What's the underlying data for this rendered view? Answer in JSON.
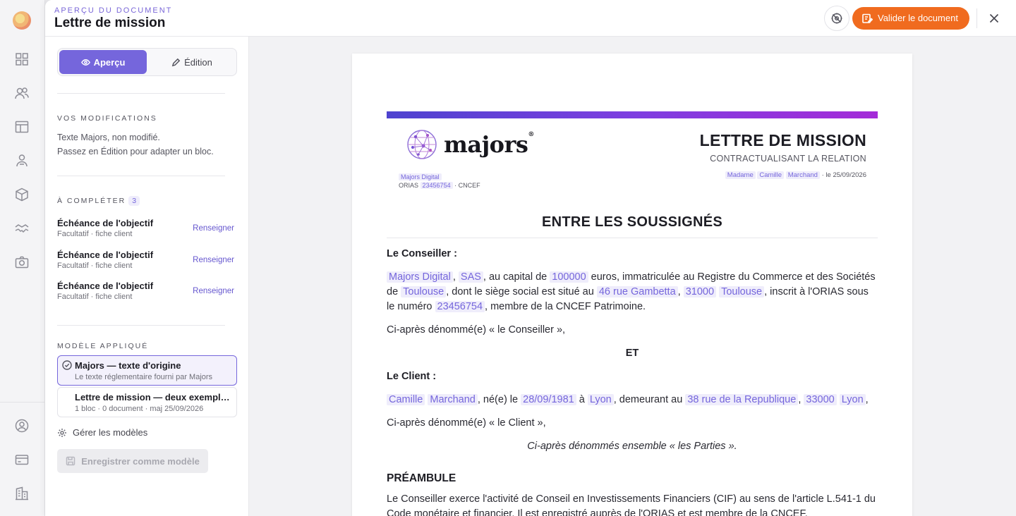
{
  "rail": {
    "icons": [
      "dashboard-icon",
      "users-icon",
      "layout-icon",
      "person-icon",
      "box-icon",
      "handshake-icon",
      "camera-icon",
      "account-icon",
      "card-icon",
      "building-icon"
    ]
  },
  "header": {
    "eyebrow": "APERÇU DU DOCUMENT",
    "title": "Lettre de mission",
    "validate_label": "Valider le document"
  },
  "panel": {
    "tabs": {
      "preview": "Aperçu",
      "edit": "Édition"
    },
    "modifications": {
      "title": "VOS MODIFICATIONS",
      "line1": "Texte Majors, non modifié.",
      "line2": "Passez en Édition pour adapter un bloc."
    },
    "todo": {
      "title": "À COMPLÉTER",
      "count": "3",
      "items": [
        {
          "title": "Échéance de l'objectif",
          "sub": "Facultatif · fiche client",
          "action": "Renseigner"
        },
        {
          "title": "Échéance de l'objectif",
          "sub": "Facultatif · fiche client",
          "action": "Renseigner"
        },
        {
          "title": "Échéance de l'objectif",
          "sub": "Facultatif · fiche client",
          "action": "Renseigner"
        }
      ]
    },
    "templates": {
      "title": "MODÈLE APPLIQUÉ",
      "items": [
        {
          "title": "Majors — texte d'origine",
          "sub": "Le texte réglementaire fourni par Majors"
        },
        {
          "title": "Lettre de mission — deux exemplaires",
          "sub": "1 bloc · 0 document · maj 25/09/2026"
        }
      ],
      "manage": "Gérer les modèles",
      "save": "Enregistrer comme modèle"
    }
  },
  "doc": {
    "brand": "majors",
    "org_name": "Majors Digital",
    "orias_label": "ORIAS",
    "orias_number": "23456754",
    "org_suffix": "· CNCEF",
    "title": "LETTRE DE MISSION",
    "subtitle": "CONTRACTUALISANT LA RELATION",
    "civility": "Madame",
    "first_name": "Camille",
    "last_name": "Marchand",
    "date_text": "· le 25/09/2026",
    "between": "ENTRE LES SOUSSIGNÉS",
    "advisor_heading": "Le Conseiller :",
    "company": "Majors Digital",
    "form": "SAS",
    "capital": "100000",
    "city": "Toulouse",
    "street": "46 rue Gambetta",
    "zip": "31000",
    "t_capital": ", au capital de",
    "t_euros": "euros, immatriculée au Registre du Commerce et des Sociétés de",
    "t_seat": ", dont le siège social est situé au",
    "t_orias": ", inscrit à l'ORIAS sous le numéro",
    "t_member": ", membre de la CNCEF Patrimoine.",
    "advisor_alias": "Ci-après dénommé(e) « le Conseiller »,",
    "et": "ET",
    "client_heading": "Le Client :",
    "client_first": "Camille",
    "client_last": "Marchand",
    "t_born": ", né(e) le",
    "birth_date": "28/09/1981",
    "t_a": "à",
    "birth_city": "Lyon",
    "t_living": ", demeurant au",
    "client_street": "38 rue de la Republique",
    "client_zip": "33000",
    "client_city": "Lyon",
    "client_alias": "Ci-après dénommé(e) « le Client »,",
    "parties": "Ci-après dénommés ensemble « les Parties ».",
    "preamble_title": "PRÉAMBULE",
    "preamble_text": "Le Conseiller exerce l'activité de Conseil en Investissements Financiers (CIF) au sens de l'article L.541-1 du Code monétaire et financier. Il est enregistré auprès de l'ORIAS et est membre de la CNCEF."
  }
}
